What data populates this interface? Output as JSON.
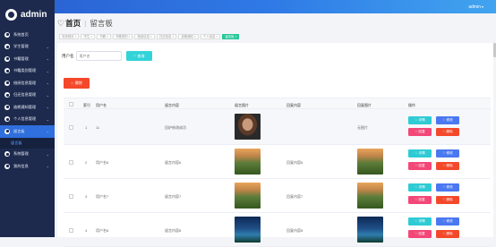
{
  "topbar": {
    "user": "admin"
  },
  "sidebar": {
    "brand": "admin",
    "items": [
      {
        "label": "系统首页",
        "has_arrow": false,
        "active": false
      },
      {
        "label": "学生管理",
        "has_arrow": true,
        "active": false
      },
      {
        "label": "书籍管理",
        "has_arrow": true,
        "active": false
      },
      {
        "label": "书籍类别管理",
        "has_arrow": true,
        "active": false
      },
      {
        "label": "借阅信息管理",
        "has_arrow": true,
        "active": false
      },
      {
        "label": "归还信息管理",
        "has_arrow": true,
        "active": false
      },
      {
        "label": "逾期通知管理",
        "has_arrow": true,
        "active": false
      },
      {
        "label": "个人信息管理",
        "has_arrow": true,
        "active": false
      },
      {
        "label": "留言板",
        "has_arrow": true,
        "active": true
      }
    ],
    "sub_item": "留言板",
    "bottom_items": [
      {
        "label": "系统管理",
        "has_arrow": true
      },
      {
        "label": "我的信息",
        "has_arrow": true
      }
    ]
  },
  "title": {
    "home": "首页",
    "current": "留言板"
  },
  "tabs": [
    {
      "label": "系统首页 ×",
      "active": false
    },
    {
      "label": "学生 ×",
      "active": false
    },
    {
      "label": "书籍 ×",
      "active": false
    },
    {
      "label": "书籍类别 ×",
      "active": false
    },
    {
      "label": "借阅信息 ×",
      "active": false
    },
    {
      "label": "归还信息 ×",
      "active": false
    },
    {
      "label": "逾期通知 ×",
      "active": false
    },
    {
      "label": "个人信息 ×",
      "active": false
    },
    {
      "label": "留言板 ×",
      "active": true
    }
  ],
  "search": {
    "label": "用户名",
    "placeholder": "用户名",
    "button": "查询"
  },
  "delete_all": "删除",
  "table": {
    "headers": [
      "索引",
      "用户名",
      "留言内容",
      "留言图片",
      "回复内容",
      "回复图片",
      "操作"
    ],
    "rows": [
      {
        "index": "1",
        "username": "11",
        "content": "回炉修改成功",
        "image": "portrait",
        "reply": "",
        "reply_image": "无图片"
      },
      {
        "index": "2",
        "username": "用户名6",
        "content": "留言内容6",
        "image": "land",
        "reply": "回复内容6",
        "reply_image": "land"
      },
      {
        "index": "3",
        "username": "用户名7",
        "content": "留言内容7",
        "image": "land",
        "reply": "回复内容7",
        "reply_image": "land"
      },
      {
        "index": "4",
        "username": "用户名8",
        "content": "留言内容8",
        "image": "night",
        "reply": "回复内容8",
        "reply_image": "night"
      }
    ],
    "actions": {
      "detail": "详情",
      "edit": "修改",
      "reply": "回复",
      "delete": "删除"
    }
  },
  "icons": {
    "heart": "heart-icon",
    "search": "search-icon"
  },
  "colors": {
    "topbar": "#2f7ae6",
    "sidebar": "#1d2a4d",
    "active_tab": "#27c79a",
    "detail": "#2fcbd4",
    "edit": "#4a78f0",
    "reply": "#f34777",
    "delete": "#f4482a"
  }
}
